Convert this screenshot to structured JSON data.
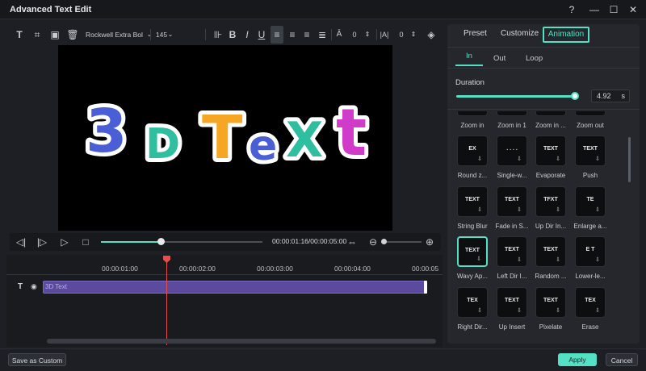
{
  "window": {
    "title": "Advanced Text Edit"
  },
  "toolbar": {
    "font": "Rockwell Extra Bol",
    "size": "145",
    "char_spacing": "0",
    "line_spacing": "0"
  },
  "preview": {
    "text_chars": [
      "3",
      "D",
      "T",
      "e",
      "X",
      "t"
    ],
    "colors": [
      "#4a5fd6",
      "#2fbfa0",
      "#f5a623",
      "#4a5fd6",
      "#2fbfa0",
      "#d03cc9"
    ]
  },
  "player": {
    "timecode": "00:00:01:16/00:00:05:00",
    "progress": 0.37
  },
  "timeline": {
    "ticks": [
      "00:00:01:00",
      "00:00:02:00",
      "00:00:03:00",
      "00:00:04:00",
      "00:00:05:0"
    ],
    "clip_label": "3D Text"
  },
  "panel": {
    "tabs": [
      "Preset",
      "Customize",
      "Animation"
    ],
    "subtabs": [
      "In",
      "Out",
      "Loop"
    ],
    "duration_label": "Duration",
    "duration_value": "4.92",
    "duration_unit": "s",
    "duration_fraction": 0.98,
    "row0_labels": [
      "Zoom in",
      "Zoom in 1",
      "Zoom in ...",
      "Zoom out"
    ],
    "rows": [
      [
        {
          "label": "Round z...",
          "thumb": "EX"
        },
        {
          "label": "Single-w...",
          "thumb": ". . . ."
        },
        {
          "label": "Evaporate",
          "thumb": "TEXT"
        },
        {
          "label": "Push",
          "thumb": "TEXT"
        }
      ],
      [
        {
          "label": "String Blur",
          "thumb": "TEXT"
        },
        {
          "label": "Fade in S...",
          "thumb": "TEXT"
        },
        {
          "label": "Up Dir In...",
          "thumb": "TFXT"
        },
        {
          "label": "Enlarge a...",
          "thumb": "TE"
        }
      ],
      [
        {
          "label": "Wavy Ap...",
          "thumb": "TEXT"
        },
        {
          "label": "Left Dir I...",
          "thumb": "TEXT"
        },
        {
          "label": "Random ...",
          "thumb": "TEXT"
        },
        {
          "label": "Lower-le...",
          "thumb": "E T"
        }
      ],
      [
        {
          "label": "Right Dir...",
          "thumb": "TEX"
        },
        {
          "label": "Up Insert",
          "thumb": "TEXT"
        },
        {
          "label": "Pixelate",
          "thumb": "TEXT"
        },
        {
          "label": "Erase",
          "thumb": "TEX"
        }
      ]
    ]
  },
  "footer": {
    "save_custom": "Save as Custom",
    "apply": "Apply",
    "cancel": "Cancel"
  },
  "colors": {
    "accent": "#54e0c4",
    "playhead": "#e84c4c",
    "clip": "#5b4a9e"
  }
}
